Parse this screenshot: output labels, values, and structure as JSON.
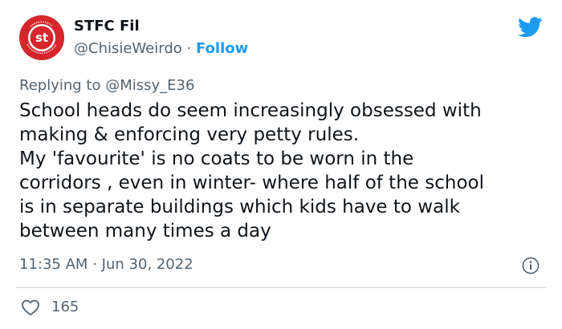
{
  "tweet": {
    "display_name": "STFC Fil",
    "handle": "@ChisieWeirdo",
    "separator": "·",
    "follow_label": "Follow",
    "replying_prefix": "Replying to",
    "replying_to": "@Missy_E36",
    "text_lines": [
      "School heads do seem increasingly obsessed with",
      "making & enforcing very petty rules.",
      "My 'favourite' is no coats to be worn in the",
      "corridors , even in winter- where half of the school",
      "is in separate buildings which kids have to walk",
      "between many times a day"
    ],
    "time": "11:35 AM",
    "date": "Jun 30, 2022",
    "like_count": "165"
  },
  "avatar": {
    "ring_text": "SUNDERLAND TOWN FOOTBALL CLUB",
    "monogram": "st",
    "colors": {
      "outer": "#d7262b",
      "ring": "#ffffff",
      "inner": "#d7262b"
    }
  },
  "colors": {
    "accent": "#1d9bf0",
    "text": "#0f1419",
    "muted": "#536471",
    "divider": "#cfd9de"
  },
  "icons": {
    "brand": "twitter-bird-icon",
    "info": "info-icon",
    "like": "heart-icon"
  }
}
